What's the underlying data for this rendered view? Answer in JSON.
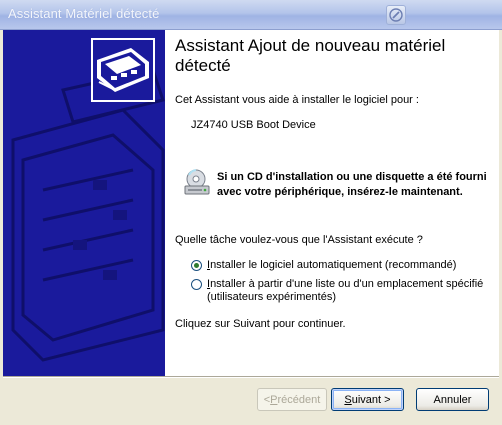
{
  "window": {
    "title": "Assistant Matériel détecté"
  },
  "wizard": {
    "heading": "Assistant Ajout de nouveau matériel détecté",
    "intro": "Cet Assistant vous aide à installer le logiciel pour :",
    "device_name": "JZ4740 USB Boot Device",
    "cd_notice": "Si un CD d'installation ou une disquette a été fourni avec votre périphérique, insérez-le maintenant.",
    "question": "Quelle tâche voulez-vous que l'Assistant exécute ?",
    "options": [
      {
        "label_first": "I",
        "label_rest": "nstaller le logiciel automatiquement (recommandé)",
        "checked": true
      },
      {
        "label_first": "I",
        "label_rest": "nstaller à partir d'une liste ou d'un emplacement spécifié (utilisateurs expérimentés)",
        "checked": false
      }
    ],
    "continue_hint": "Cliquez sur Suivant pour continuer."
  },
  "buttons": {
    "back_prefix": "< ",
    "back_mnemonic": "P",
    "back_rest": "récédent",
    "next_mnemonic": "S",
    "next_rest": "uivant >",
    "cancel": "Annuler"
  },
  "icons": {
    "titlebar": "help-icon",
    "sidepanel": "hardware-card-icon",
    "notice": "cd-drive-icon"
  },
  "colors": {
    "side_panel": "#1a1a9c",
    "window_bg": "#ece9d8"
  }
}
